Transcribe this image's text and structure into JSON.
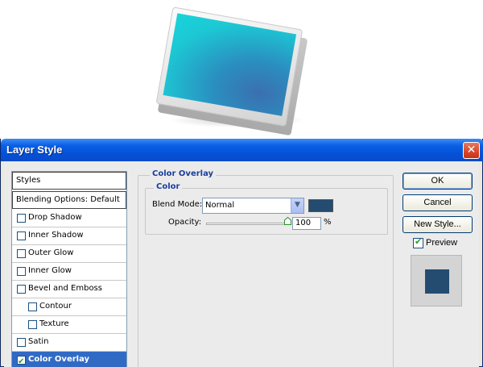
{
  "dialog": {
    "title": "Layer Style",
    "close_glyph": "✕"
  },
  "styles_list": {
    "items": [
      {
        "label": "Styles",
        "type": "header"
      },
      {
        "label": "Blending Options: Default",
        "type": "header"
      },
      {
        "label": "Drop Shadow",
        "checked": false
      },
      {
        "label": "Inner Shadow",
        "checked": false
      },
      {
        "label": "Outer Glow",
        "checked": false
      },
      {
        "label": "Inner Glow",
        "checked": false
      },
      {
        "label": "Bevel and Emboss",
        "checked": false
      },
      {
        "label": "Contour",
        "checked": false,
        "indent": true
      },
      {
        "label": "Texture",
        "checked": false,
        "indent": true
      },
      {
        "label": "Satin",
        "checked": false
      },
      {
        "label": "Color Overlay",
        "checked": true,
        "selected": true
      }
    ]
  },
  "panel": {
    "section_title": "Color Overlay",
    "group_title": "Color",
    "blend_mode_label": "Blend Mode:",
    "blend_mode_value": "Normal",
    "opacity_label": "Opacity:",
    "opacity_value": "100",
    "opacity_unit": "%",
    "opacity_fraction": 1.0,
    "overlay_color": "#244c70"
  },
  "buttons": {
    "ok": "OK",
    "cancel": "Cancel",
    "new_style": "New Style..."
  },
  "preview": {
    "label": "Preview",
    "checked": true,
    "color": "#244c70"
  }
}
